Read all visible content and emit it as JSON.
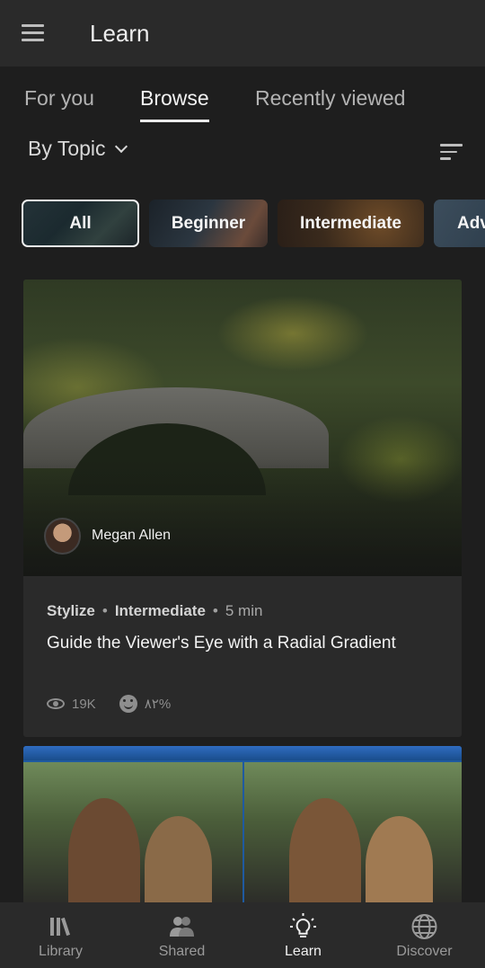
{
  "header": {
    "title": "Learn",
    "menu_icon": "hamburger-menu-icon"
  },
  "tabs": [
    {
      "label": "For you",
      "active": false
    },
    {
      "label": "Browse",
      "active": true
    },
    {
      "label": "Recently viewed",
      "active": false
    }
  ],
  "filter": {
    "selected": "By Topic",
    "sort_icon": "sort-lines-icon"
  },
  "chips": [
    {
      "label": "All",
      "selected": true
    },
    {
      "label": "Beginner",
      "selected": false
    },
    {
      "label": "Intermediate",
      "selected": false
    },
    {
      "label": "Adv",
      "selected": false
    }
  ],
  "cards": [
    {
      "author": "Megan Allen",
      "category": "Stylize",
      "level": "Intermediate",
      "duration": "5 min",
      "title": "Guide the Viewer's Eye with a Radial Gradient",
      "views": "19K",
      "rating": "٨٢%"
    }
  ],
  "bottom_nav": [
    {
      "label": "Library",
      "icon": "library-books-icon",
      "active": false
    },
    {
      "label": "Shared",
      "icon": "people-icon",
      "active": false
    },
    {
      "label": "Learn",
      "icon": "lightbulb-icon",
      "active": true
    },
    {
      "label": "Discover",
      "icon": "globe-icon",
      "active": false
    }
  ],
  "colors": {
    "background": "#1e1e1e",
    "bar": "#2a2a2a",
    "text": "#e8e8e8",
    "muted": "#9a9a9a"
  }
}
